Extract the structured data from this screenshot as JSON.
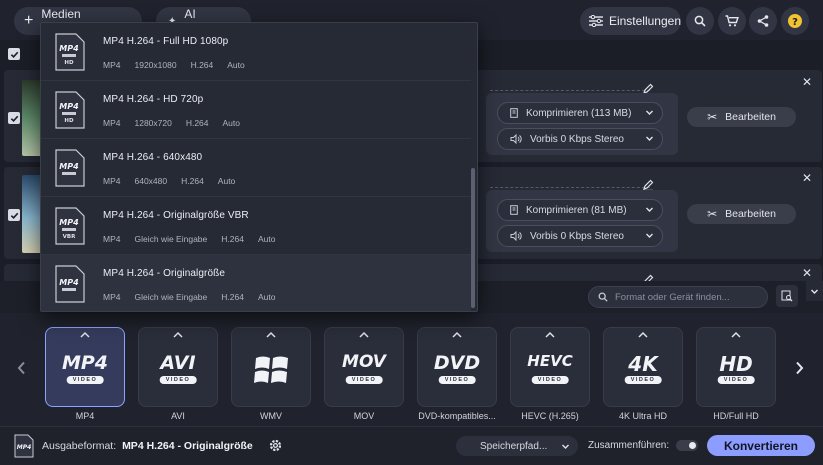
{
  "topbar": {
    "add_media_label": "Medien hinzufügen",
    "ai_upscaling_label": "AI Upscaling",
    "settings_label": "Einstellungen"
  },
  "files": [
    {
      "compress_label": "Komprimieren (113 MB)",
      "audio_label": "Vorbis 0 Kbps Stereo",
      "edit_label": "Bearbeiten"
    },
    {
      "compress_label": "Komprimieren (81 MB)",
      "audio_label": "Vorbis 0 Kbps Stereo",
      "edit_label": "Bearbeiten"
    }
  ],
  "dropdown": {
    "items": [
      {
        "title": "MP4 H.264 - Full HD 1080p",
        "icon_badge": "HD",
        "meta": [
          "MP4",
          "1920x1080",
          "H.264",
          "Auto"
        ]
      },
      {
        "title": "MP4 H.264 - HD 720p",
        "icon_badge": "HD",
        "meta": [
          "MP4",
          "1280x720",
          "H.264",
          "Auto"
        ]
      },
      {
        "title": "MP4 H.264 - 640x480",
        "icon_badge": "",
        "meta": [
          "MP4",
          "640x480",
          "H.264",
          "Auto"
        ]
      },
      {
        "title": "MP4 H.264 - Originalgröße VBR",
        "icon_badge": "VBR",
        "meta": [
          "MP4",
          "Gleich wie Eingabe",
          "H.264",
          "Auto"
        ]
      },
      {
        "title": "MP4 H.264 - Originalgröße",
        "icon_badge": "",
        "meta": [
          "MP4",
          "Gleich wie Eingabe",
          "H.264",
          "Auto"
        ]
      }
    ],
    "icon_text": "MP4"
  },
  "format_search": {
    "placeholder": "Format oder Gerät finden..."
  },
  "formats": [
    {
      "logo": "MP4",
      "sub": "VIDEO",
      "label": "MP4"
    },
    {
      "logo": "AVI",
      "sub": "VIDEO",
      "label": "AVI"
    },
    {
      "logo": "",
      "sub": "",
      "label": "WMV"
    },
    {
      "logo": "MOV",
      "sub": "VIDEO",
      "label": "MOV"
    },
    {
      "logo": "DVD",
      "sub": "VIDEO",
      "label": "DVD-kompatibles..."
    },
    {
      "logo": "HEVC",
      "sub": "VIDEO",
      "label": "HEVC (H.265)"
    },
    {
      "logo": "4K",
      "sub": "VIDEO",
      "label": "4K Ultra HD"
    },
    {
      "logo": "HD",
      "sub": "VIDEO",
      "label": "HD/Full HD"
    }
  ],
  "bottombar": {
    "output_prefix": "Ausgabeformat:",
    "output_value": "MP4 H.264 - Originalgröße",
    "save_path_label": "Speicherpfad...",
    "merge_label": "Zusammenführen:",
    "convert_label": "Konvertieren",
    "output_icon_text": "MP4"
  },
  "colors": {
    "accent": "#8d9dff",
    "background": "#1b1e27"
  }
}
